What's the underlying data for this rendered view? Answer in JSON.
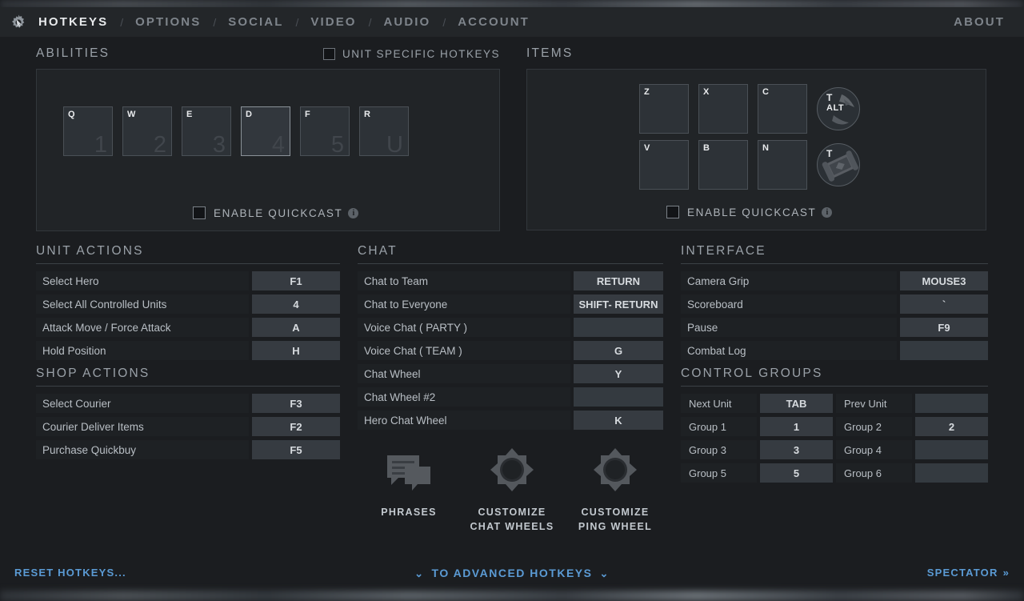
{
  "header": {
    "gear_icon": "gear-cursor-icon",
    "nav": [
      {
        "label": "HOTKEYS",
        "active": true
      },
      {
        "label": "OPTIONS",
        "active": false
      },
      {
        "label": "SOCIAL",
        "active": false
      },
      {
        "label": "VIDEO",
        "active": false
      },
      {
        "label": "AUDIO",
        "active": false
      },
      {
        "label": "ACCOUNT",
        "active": false
      }
    ],
    "separator": "/",
    "about_label": "ABOUT"
  },
  "abilities": {
    "title": "ABILITIES",
    "unit_specific": {
      "label": "UNIT SPECIFIC HOTKEYS",
      "checked": false
    },
    "slots": [
      {
        "key": "Q",
        "num": "1",
        "selected": false
      },
      {
        "key": "W",
        "num": "2",
        "selected": false
      },
      {
        "key": "E",
        "num": "3",
        "selected": false
      },
      {
        "key": "D",
        "num": "4",
        "selected": true
      },
      {
        "key": "F",
        "num": "5",
        "selected": false
      },
      {
        "key": "R",
        "num": "U",
        "selected": false
      }
    ],
    "quickcast": {
      "label": "ENABLE QUICKCAST",
      "checked": false,
      "info_icon": "info-icon"
    }
  },
  "items": {
    "title": "ITEMS",
    "row1": [
      {
        "key": "Z"
      },
      {
        "key": "X"
      },
      {
        "key": "C"
      }
    ],
    "row2": [
      {
        "key": "V"
      },
      {
        "key": "B"
      },
      {
        "key": "N"
      }
    ],
    "circle1": {
      "key": "T",
      "key2": "ALT",
      "icon": "tp-scroll-icon"
    },
    "circle2": {
      "key": "T",
      "key2": "",
      "icon": "neutral-item-icon"
    },
    "quickcast": {
      "label": "ENABLE QUICKCAST",
      "checked": false,
      "info_icon": "info-icon"
    }
  },
  "unit_actions": {
    "title": "UNIT ACTIONS",
    "rows": [
      {
        "label": "Select Hero",
        "key": "F1"
      },
      {
        "label": "Select All Controlled Units",
        "key": "4"
      },
      {
        "label": "Attack Move / Force Attack",
        "key": "A"
      },
      {
        "label": "Hold Position",
        "key": "H"
      }
    ]
  },
  "shop_actions": {
    "title": "SHOP ACTIONS",
    "rows": [
      {
        "label": "Select Courier",
        "key": "F3"
      },
      {
        "label": "Courier Deliver Items",
        "key": "F2"
      },
      {
        "label": "Purchase Quickbuy",
        "key": "F5"
      }
    ]
  },
  "chat": {
    "title": "CHAT",
    "rows": [
      {
        "label": "Chat to Team",
        "key": "RETURN"
      },
      {
        "label": "Chat to Everyone",
        "key": "SHIFT- RETURN"
      },
      {
        "label": "Voice Chat ( PARTY )",
        "key": ""
      },
      {
        "label": "Voice Chat ( TEAM )",
        "key": "G"
      },
      {
        "label": "Chat Wheel",
        "key": "Y"
      },
      {
        "label": "Chat Wheel #2",
        "key": ""
      },
      {
        "label": "Hero Chat Wheel",
        "key": "K"
      }
    ]
  },
  "interface": {
    "title": "INTERFACE",
    "rows": [
      {
        "label": "Camera Grip",
        "key": "MOUSE3"
      },
      {
        "label": "Scoreboard",
        "key": "`"
      },
      {
        "label": "Pause",
        "key": "F9"
      },
      {
        "label": "Combat Log",
        "key": ""
      }
    ]
  },
  "control_groups": {
    "title": "CONTROL GROUPS",
    "rows": [
      [
        {
          "label": "Next Unit",
          "key": "TAB"
        },
        {
          "label": "Prev Unit",
          "key": ""
        }
      ],
      [
        {
          "label": "Group 1",
          "key": "1"
        },
        {
          "label": "Group 2",
          "key": "2"
        }
      ],
      [
        {
          "label": "Group 3",
          "key": "3"
        },
        {
          "label": "Group 4",
          "key": ""
        }
      ],
      [
        {
          "label": "Group 5",
          "key": "5"
        },
        {
          "label": "Group 6",
          "key": ""
        }
      ]
    ]
  },
  "wheel_buttons": [
    {
      "caption": "PHRASES",
      "icon": "speech-bubbles-icon"
    },
    {
      "caption": "CUSTOMIZE\nCHAT WHEELS",
      "icon": "chat-wheel-icon"
    },
    {
      "caption": "CUSTOMIZE\nPING WHEEL",
      "icon": "ping-wheel-icon"
    }
  ],
  "footer": {
    "reset_label": "RESET HOTKEYS...",
    "advanced_label": "TO ADVANCED HOTKEYS",
    "advanced_chevron": "⌄",
    "spectator_label": "SPECTATOR",
    "spectator_chevron": "»"
  },
  "colors": {
    "accent_link": "#5b9bd5",
    "panel_bg": "#212427",
    "row_bg": "#1e2124",
    "key_bg": "#363b41",
    "text": "#b9bfc5"
  }
}
